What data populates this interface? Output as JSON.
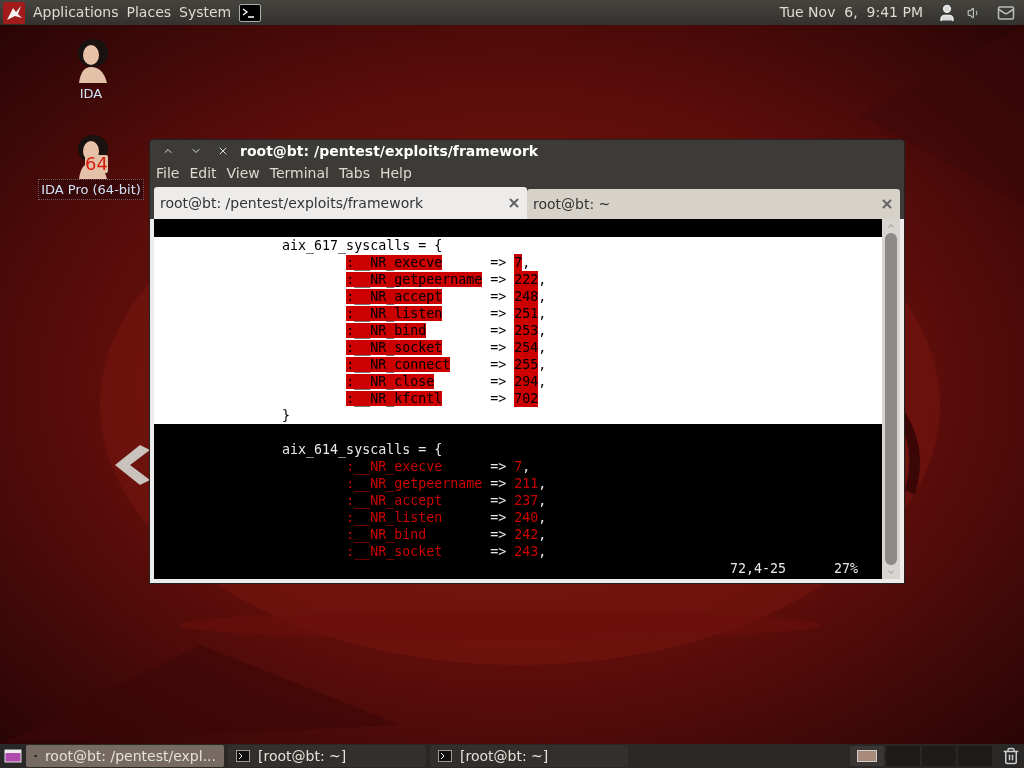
{
  "top_panel": {
    "menus": [
      "Applications",
      "Places",
      "System"
    ],
    "clock": "Tue Nov  6,  9:41 PM"
  },
  "desktop_icons": [
    {
      "label": "IDA",
      "selected": false
    },
    {
      "label": "IDA Pro (64-bit)",
      "badge": "64",
      "selected": true
    }
  ],
  "window": {
    "title": "root@bt: /pentest/exploits/framework",
    "menu": [
      "File",
      "Edit",
      "View",
      "Terminal",
      "Tabs",
      "Help"
    ],
    "tabs": [
      {
        "label": "root@bt: /pentest/exploits/framework",
        "selected": true
      },
      {
        "label": "root@bt: ~",
        "selected": false
      }
    ],
    "terminal": {
      "lines": [
        {
          "kind": "blank",
          "selected": false
        },
        {
          "kind": "text",
          "text": "aix_617_syscalls = {",
          "selected": true
        },
        {
          "kind": "entry",
          "key": ":__NR_execve",
          "arrow": "=>",
          "value": "7",
          "end": ",",
          "selected": true
        },
        {
          "kind": "entry",
          "key": ":__NR_getpeername",
          "arrow": "=>",
          "value": "222",
          "end": ",",
          "selected": true
        },
        {
          "kind": "entry",
          "key": ":__NR_accept",
          "arrow": "=>",
          "value": "248",
          "end": ",",
          "selected": true
        },
        {
          "kind": "entry",
          "key": ":__NR_listen",
          "arrow": "=>",
          "value": "251",
          "end": ",",
          "selected": true
        },
        {
          "kind": "entry",
          "key": ":__NR_bind",
          "arrow": "=>",
          "value": "253",
          "end": ",",
          "selected": true
        },
        {
          "kind": "entry",
          "key": ":__NR_socket",
          "arrow": "=>",
          "value": "254",
          "end": ",",
          "selected": true
        },
        {
          "kind": "entry",
          "key": ":__NR_connect",
          "arrow": "=>",
          "value": "255",
          "end": ",",
          "selected": true
        },
        {
          "kind": "entry",
          "key": ":__NR_close",
          "arrow": "=>",
          "value": "294",
          "end": ",",
          "selected": true
        },
        {
          "kind": "entry",
          "key": ":__NR_kfcntl",
          "arrow": "=>",
          "value": "702",
          "selected": true
        },
        {
          "kind": "text",
          "text": "}",
          "selected": true
        },
        {
          "kind": "blank",
          "selected": false
        },
        {
          "kind": "text",
          "text": "aix_614_syscalls = {",
          "selected": false
        },
        {
          "kind": "entry",
          "key": ":__NR_execve",
          "arrow": "=>",
          "value": "7",
          "end": ",",
          "selected": false
        },
        {
          "kind": "entry",
          "key": ":__NR_getpeername",
          "arrow": "=>",
          "value": "211",
          "end": ",",
          "selected": false
        },
        {
          "kind": "entry",
          "key": ":__NR_accept",
          "arrow": "=>",
          "value": "237",
          "end": ",",
          "selected": false
        },
        {
          "kind": "entry",
          "key": ":__NR_listen",
          "arrow": "=>",
          "value": "240",
          "end": ",",
          "selected": false
        },
        {
          "kind": "entry",
          "key": ":__NR_bind",
          "arrow": "=>",
          "value": "242",
          "end": ",",
          "selected": false
        },
        {
          "kind": "entry",
          "key": ":__NR_socket",
          "arrow": "=>",
          "value": "243",
          "end": ",",
          "selected": false
        }
      ],
      "status": {
        "position": "72,4-25",
        "percent": "27%"
      }
    }
  },
  "taskbar": {
    "tasks": [
      {
        "label": "root@bt: /pentest/expl...",
        "selected": true
      },
      {
        "label": "[root@bt: ~]",
        "selected": false
      },
      {
        "label": "[root@bt: ~]",
        "selected": false
      }
    ],
    "workspaces": [
      {
        "selected": true
      },
      {
        "selected": false
      },
      {
        "selected": false
      },
      {
        "selected": false
      }
    ]
  }
}
